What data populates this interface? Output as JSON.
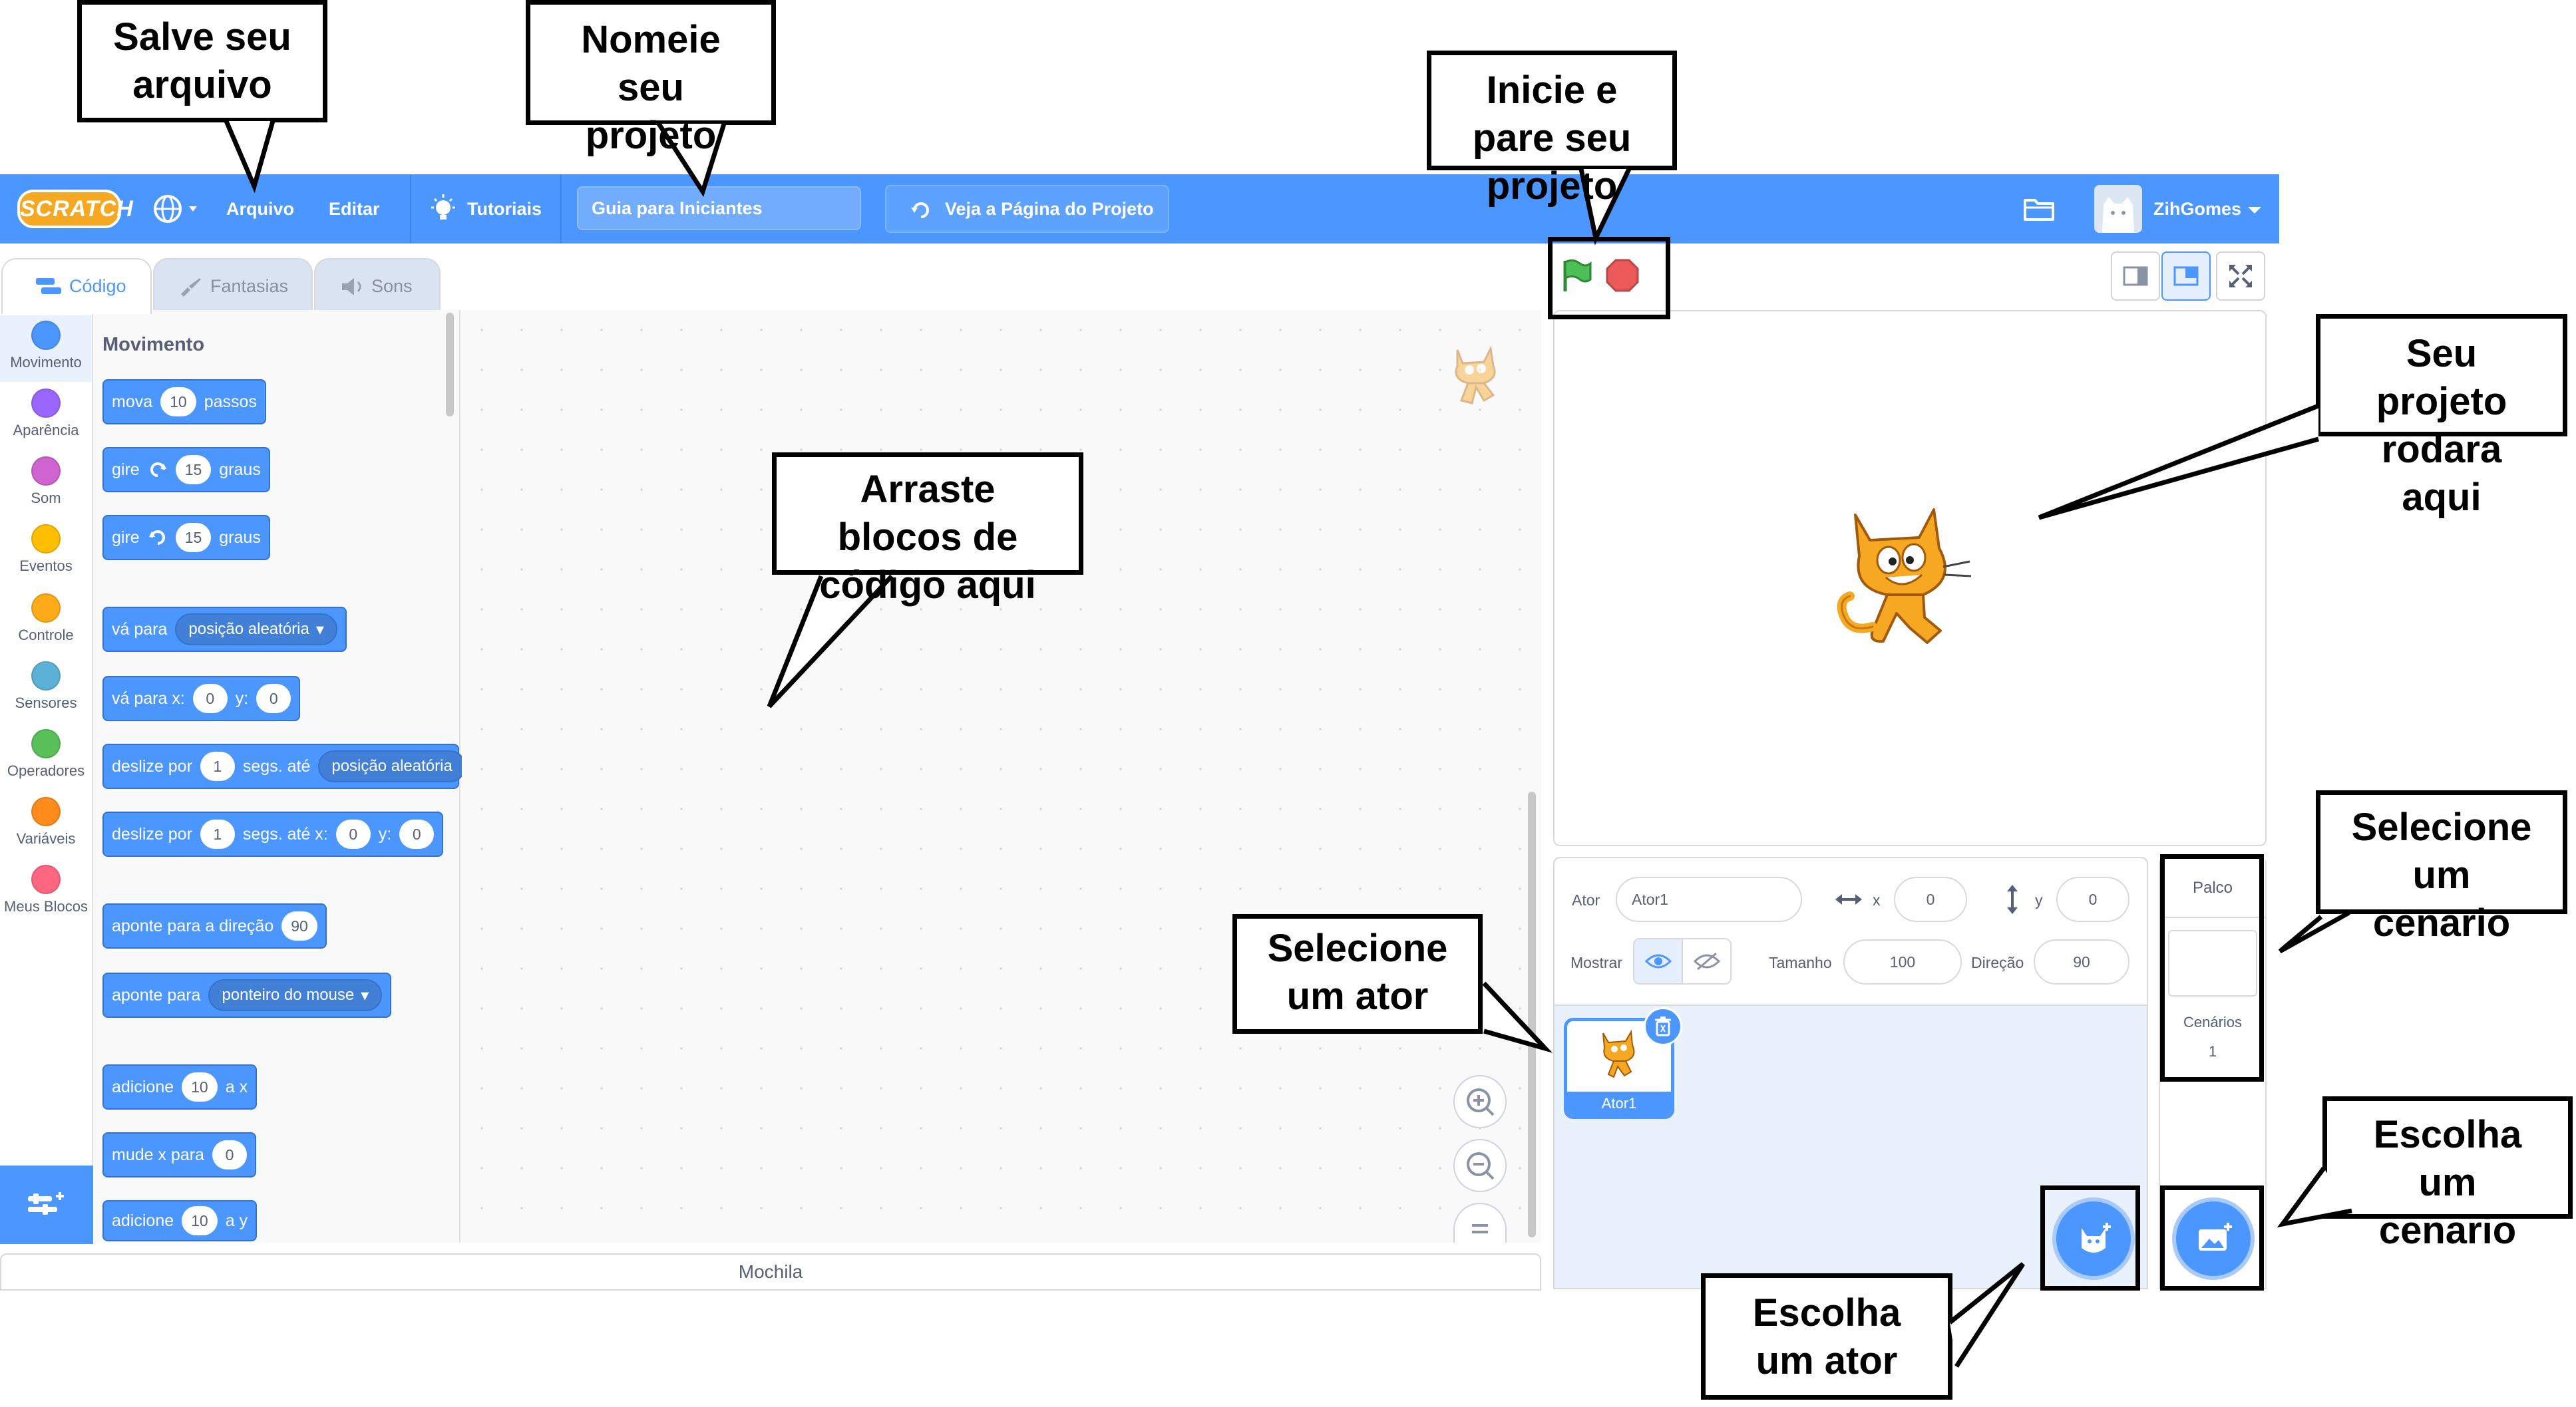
{
  "menu": {
    "logo": "SCRATCH",
    "file": "Arquivo",
    "edit": "Editar",
    "tutorials": "Tutoriais",
    "project_title": "Guia para Iniciantes",
    "see_project_page": "Veja a Página do Projeto",
    "username": "ZihGomes"
  },
  "tabs": {
    "code": "Código",
    "costumes": "Fantasias",
    "sounds": "Sons"
  },
  "categories": [
    {
      "label": "Movimento",
      "color": "#4c97ff"
    },
    {
      "label": "Aparência",
      "color": "#9966ff"
    },
    {
      "label": "Som",
      "color": "#cf63cf"
    },
    {
      "label": "Eventos",
      "color": "#ffbf00"
    },
    {
      "label": "Controle",
      "color": "#ffab19"
    },
    {
      "label": "Sensores",
      "color": "#5cb1d6"
    },
    {
      "label": "Operadores",
      "color": "#59c059"
    },
    {
      "label": "Variáveis",
      "color": "#ff8c1a"
    },
    {
      "label": "Meus Blocos",
      "color": "#ff6680"
    }
  ],
  "palette": {
    "heading": "Movimento",
    "move": {
      "a": "mova",
      "n": "10",
      "b": "passos"
    },
    "turn_right": {
      "a": "gire",
      "n": "15",
      "b": "graus"
    },
    "turn_left": {
      "a": "gire",
      "n": "15",
      "b": "graus"
    },
    "goto": {
      "a": "vá para",
      "menu": "posição aleatória"
    },
    "goto_xy": {
      "a": "vá para x:",
      "x": "0",
      "b": "y:",
      "y": "0"
    },
    "glide": {
      "a": "deslize por",
      "n": "1",
      "b": "segs. até",
      "menu": "posição aleatória"
    },
    "glide_xy": {
      "a": "deslize por",
      "n": "1",
      "b": "segs. até x:",
      "x": "0",
      "c": "y:",
      "y": "0"
    },
    "point_dir": {
      "a": "aponte para a direção",
      "n": "90"
    },
    "point_to": {
      "a": "aponte para",
      "menu": "ponteiro do mouse"
    },
    "change_x": {
      "a": "adicione",
      "n": "10",
      "b": "a x"
    },
    "set_x": {
      "a": "mude x para",
      "n": "0"
    },
    "change_y": {
      "a": "adicione",
      "n": "10",
      "b": "a y"
    }
  },
  "backpack": "Mochila",
  "sprite_info": {
    "sprite_label": "Ator",
    "sprite_name": "Ator1",
    "x_label": "x",
    "x": "0",
    "y_label": "y",
    "y": "0",
    "show_label": "Mostrar",
    "size_label": "Tamanho",
    "size": "100",
    "direction_label": "Direção",
    "direction": "90"
  },
  "sprite_tile": {
    "name": "Ator1"
  },
  "stage_pane": {
    "title": "Palco",
    "backdrops_label": "Cenários",
    "backdrops_count": "1"
  },
  "callouts": {
    "save": "Salve seu\narquivo",
    "name": "Nomeie\nseu\nprojeto",
    "start_stop": "Inicie e\npare seu\nprojeto",
    "runs_here": "Seu\nprojeto\nrodara\naqui",
    "drag_blocks": "Arraste\nblocos de\ncódigo aqui",
    "select_sprite": "Selecione\num ator",
    "select_backdrop": "Selecione\num\ncenario",
    "choose_backdrop": "Escolha\num\ncenario",
    "choose_sprite": "Escolha\num ator"
  },
  "colors": {
    "menu_blue": "#4c97ff",
    "motion_block": "#4c97ff",
    "green_flag": "#4cbf56",
    "stop": "#ec5959",
    "cat_orange": "#f7a823"
  },
  "icons": [
    "globe-icon",
    "bulb-icon",
    "remix-icon",
    "folder-icon",
    "green-flag-icon",
    "stop-icon",
    "zoom-in-icon",
    "zoom-out-icon",
    "zoom-reset-icon",
    "eye-icon",
    "eye-closed-icon",
    "trash-icon",
    "choose-sprite-icon",
    "choose-backdrop-icon",
    "extension-icon"
  ]
}
